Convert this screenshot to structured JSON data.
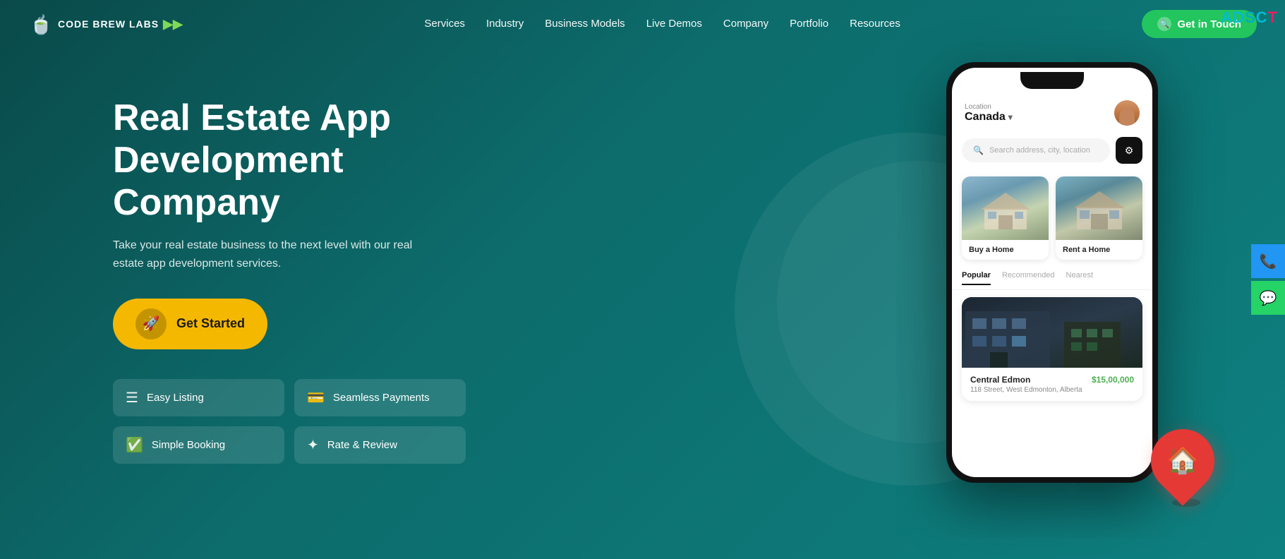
{
  "brand": {
    "name": "CODE BREW LABS",
    "tagline": "Real Estate App Development Company"
  },
  "navbar": {
    "logo_text": "CODE BREW LABS",
    "links": [
      "Services",
      "Industry",
      "Business Models",
      "Live Demos",
      "Company",
      "Portfolio",
      "Resources"
    ],
    "cta_label": "Get in Touch"
  },
  "hero": {
    "title_line1": "Real Estate App",
    "title_line2": "Development Company",
    "subtitle": "Take your real estate business to the next level with our real estate app development services.",
    "cta_label": "Get Started"
  },
  "features": [
    {
      "icon": "☰",
      "label": "Easy Listing"
    },
    {
      "icon": "💳",
      "label": "Seamless Payments"
    },
    {
      "icon": "✅",
      "label": "Simple Booking"
    },
    {
      "icon": "✦",
      "label": "Rate & Review"
    }
  ],
  "phone_mock": {
    "location_label": "Location",
    "location_value": "Canada",
    "search_placeholder": "Search address, city, location",
    "categories": [
      "Buy a Home",
      "Rent a Home"
    ],
    "tabs": [
      "Popular",
      "Recommended",
      "Nearest"
    ],
    "featured_property": {
      "name": "Central Edmon",
      "address": "118 Street, West Edmonton, Alberta",
      "price": "$15,00,000"
    }
  },
  "adscct": {
    "text_a": "A",
    "text_d": "D",
    "text_s": "S",
    "text_c": "C",
    "text_t": "T",
    "full": "ADSCТ"
  },
  "side_buttons": {
    "phone_icon": "📞",
    "whatsapp_icon": "💬"
  }
}
